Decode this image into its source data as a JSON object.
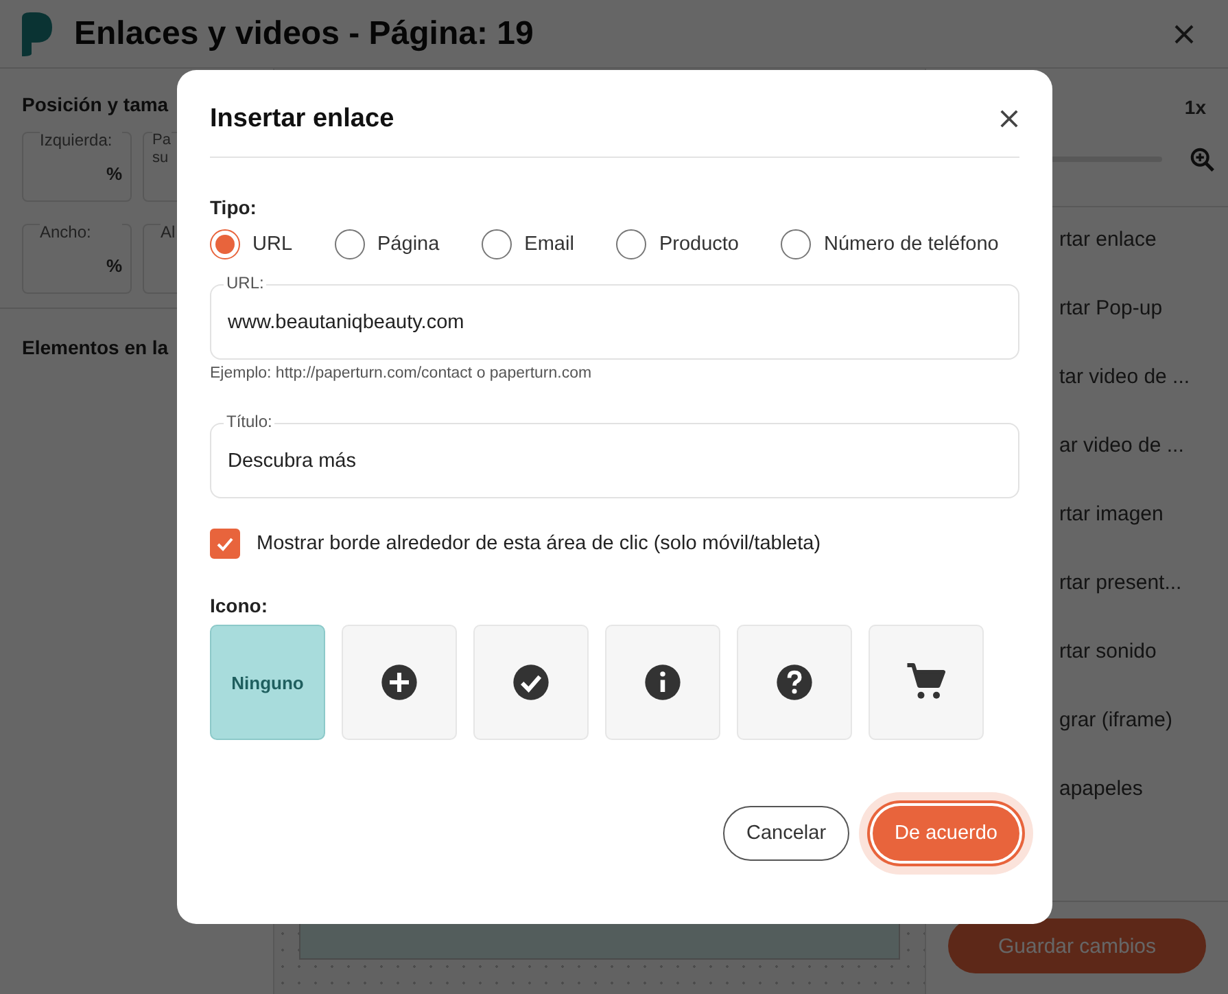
{
  "window": {
    "title": "Enlaces y videos - Página: 19"
  },
  "left_panel": {
    "section_title": "Posición y tama",
    "fields": [
      {
        "label": "Izquierda:",
        "unit": "%"
      },
      {
        "label": "Pa su"
      },
      {
        "label": "Ancho:",
        "unit": "%"
      },
      {
        "label": "Al"
      }
    ],
    "elements_title": "Elementos en la"
  },
  "right_panel": {
    "zoom": "1x",
    "items": [
      "rtar enlace",
      "rtar Pop-up",
      "tar video de ...",
      "ar video de ...",
      "rtar imagen",
      "rtar present...",
      "rtar sonido",
      "grar (iframe)",
      "apapeles"
    ],
    "save_button": "Guardar cambios"
  },
  "dialog": {
    "title": "Insertar enlace",
    "type_label": "Tipo:",
    "types": [
      {
        "label": "URL",
        "selected": true
      },
      {
        "label": "Página",
        "selected": false
      },
      {
        "label": "Email",
        "selected": false
      },
      {
        "label": "Producto",
        "selected": false
      },
      {
        "label": "Número de teléfono",
        "selected": false
      }
    ],
    "url_field": {
      "label": "URL:",
      "value": "www.beautaniqbeauty.com"
    },
    "hint": "Ejemplo: http://paperturn.com/contact o paperturn.com",
    "title_field": {
      "label": "Título:",
      "value": "Descubra más"
    },
    "show_border": {
      "label": "Mostrar borde alrededor de esta área de clic (solo móvil/tableta)",
      "checked": true
    },
    "icon_label": "Icono:",
    "icons": [
      {
        "kind": "none",
        "label": "Ninguno",
        "selected": true
      },
      {
        "kind": "plus",
        "selected": false
      },
      {
        "kind": "check",
        "selected": false
      },
      {
        "kind": "info",
        "selected": false
      },
      {
        "kind": "question",
        "selected": false
      },
      {
        "kind": "cart",
        "selected": false
      }
    ],
    "buttons": {
      "cancel": "Cancelar",
      "ok": "De acuerdo"
    }
  }
}
